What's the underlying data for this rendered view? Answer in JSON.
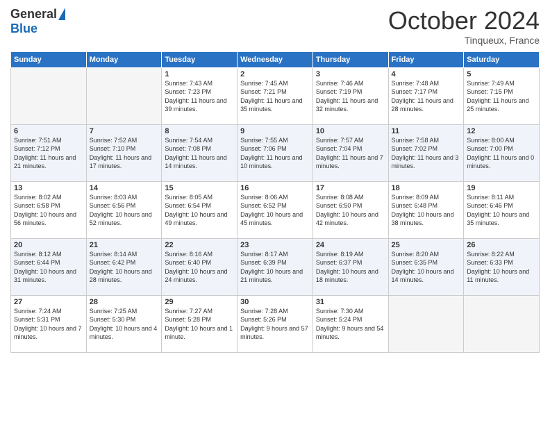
{
  "logo": {
    "general": "General",
    "blue": "Blue"
  },
  "title": "October 2024",
  "location": "Tinqueux, France",
  "days_header": [
    "Sunday",
    "Monday",
    "Tuesday",
    "Wednesday",
    "Thursday",
    "Friday",
    "Saturday"
  ],
  "weeks": [
    [
      {
        "day": "",
        "sunrise": "",
        "sunset": "",
        "daylight": ""
      },
      {
        "day": "",
        "sunrise": "",
        "sunset": "",
        "daylight": ""
      },
      {
        "day": "1",
        "sunrise": "Sunrise: 7:43 AM",
        "sunset": "Sunset: 7:23 PM",
        "daylight": "Daylight: 11 hours and 39 minutes."
      },
      {
        "day": "2",
        "sunrise": "Sunrise: 7:45 AM",
        "sunset": "Sunset: 7:21 PM",
        "daylight": "Daylight: 11 hours and 35 minutes."
      },
      {
        "day": "3",
        "sunrise": "Sunrise: 7:46 AM",
        "sunset": "Sunset: 7:19 PM",
        "daylight": "Daylight: 11 hours and 32 minutes."
      },
      {
        "day": "4",
        "sunrise": "Sunrise: 7:48 AM",
        "sunset": "Sunset: 7:17 PM",
        "daylight": "Daylight: 11 hours and 28 minutes."
      },
      {
        "day": "5",
        "sunrise": "Sunrise: 7:49 AM",
        "sunset": "Sunset: 7:15 PM",
        "daylight": "Daylight: 11 hours and 25 minutes."
      }
    ],
    [
      {
        "day": "6",
        "sunrise": "Sunrise: 7:51 AM",
        "sunset": "Sunset: 7:12 PM",
        "daylight": "Daylight: 11 hours and 21 minutes."
      },
      {
        "day": "7",
        "sunrise": "Sunrise: 7:52 AM",
        "sunset": "Sunset: 7:10 PM",
        "daylight": "Daylight: 11 hours and 17 minutes."
      },
      {
        "day": "8",
        "sunrise": "Sunrise: 7:54 AM",
        "sunset": "Sunset: 7:08 PM",
        "daylight": "Daylight: 11 hours and 14 minutes."
      },
      {
        "day": "9",
        "sunrise": "Sunrise: 7:55 AM",
        "sunset": "Sunset: 7:06 PM",
        "daylight": "Daylight: 11 hours and 10 minutes."
      },
      {
        "day": "10",
        "sunrise": "Sunrise: 7:57 AM",
        "sunset": "Sunset: 7:04 PM",
        "daylight": "Daylight: 11 hours and 7 minutes."
      },
      {
        "day": "11",
        "sunrise": "Sunrise: 7:58 AM",
        "sunset": "Sunset: 7:02 PM",
        "daylight": "Daylight: 11 hours and 3 minutes."
      },
      {
        "day": "12",
        "sunrise": "Sunrise: 8:00 AM",
        "sunset": "Sunset: 7:00 PM",
        "daylight": "Daylight: 11 hours and 0 minutes."
      }
    ],
    [
      {
        "day": "13",
        "sunrise": "Sunrise: 8:02 AM",
        "sunset": "Sunset: 6:58 PM",
        "daylight": "Daylight: 10 hours and 56 minutes."
      },
      {
        "day": "14",
        "sunrise": "Sunrise: 8:03 AM",
        "sunset": "Sunset: 6:56 PM",
        "daylight": "Daylight: 10 hours and 52 minutes."
      },
      {
        "day": "15",
        "sunrise": "Sunrise: 8:05 AM",
        "sunset": "Sunset: 6:54 PM",
        "daylight": "Daylight: 10 hours and 49 minutes."
      },
      {
        "day": "16",
        "sunrise": "Sunrise: 8:06 AM",
        "sunset": "Sunset: 6:52 PM",
        "daylight": "Daylight: 10 hours and 45 minutes."
      },
      {
        "day": "17",
        "sunrise": "Sunrise: 8:08 AM",
        "sunset": "Sunset: 6:50 PM",
        "daylight": "Daylight: 10 hours and 42 minutes."
      },
      {
        "day": "18",
        "sunrise": "Sunrise: 8:09 AM",
        "sunset": "Sunset: 6:48 PM",
        "daylight": "Daylight: 10 hours and 38 minutes."
      },
      {
        "day": "19",
        "sunrise": "Sunrise: 8:11 AM",
        "sunset": "Sunset: 6:46 PM",
        "daylight": "Daylight: 10 hours and 35 minutes."
      }
    ],
    [
      {
        "day": "20",
        "sunrise": "Sunrise: 8:12 AM",
        "sunset": "Sunset: 6:44 PM",
        "daylight": "Daylight: 10 hours and 31 minutes."
      },
      {
        "day": "21",
        "sunrise": "Sunrise: 8:14 AM",
        "sunset": "Sunset: 6:42 PM",
        "daylight": "Daylight: 10 hours and 28 minutes."
      },
      {
        "day": "22",
        "sunrise": "Sunrise: 8:16 AM",
        "sunset": "Sunset: 6:40 PM",
        "daylight": "Daylight: 10 hours and 24 minutes."
      },
      {
        "day": "23",
        "sunrise": "Sunrise: 8:17 AM",
        "sunset": "Sunset: 6:39 PM",
        "daylight": "Daylight: 10 hours and 21 minutes."
      },
      {
        "day": "24",
        "sunrise": "Sunrise: 8:19 AM",
        "sunset": "Sunset: 6:37 PM",
        "daylight": "Daylight: 10 hours and 18 minutes."
      },
      {
        "day": "25",
        "sunrise": "Sunrise: 8:20 AM",
        "sunset": "Sunset: 6:35 PM",
        "daylight": "Daylight: 10 hours and 14 minutes."
      },
      {
        "day": "26",
        "sunrise": "Sunrise: 8:22 AM",
        "sunset": "Sunset: 6:33 PM",
        "daylight": "Daylight: 10 hours and 11 minutes."
      }
    ],
    [
      {
        "day": "27",
        "sunrise": "Sunrise: 7:24 AM",
        "sunset": "Sunset: 5:31 PM",
        "daylight": "Daylight: 10 hours and 7 minutes."
      },
      {
        "day": "28",
        "sunrise": "Sunrise: 7:25 AM",
        "sunset": "Sunset: 5:30 PM",
        "daylight": "Daylight: 10 hours and 4 minutes."
      },
      {
        "day": "29",
        "sunrise": "Sunrise: 7:27 AM",
        "sunset": "Sunset: 5:28 PM",
        "daylight": "Daylight: 10 hours and 1 minute."
      },
      {
        "day": "30",
        "sunrise": "Sunrise: 7:28 AM",
        "sunset": "Sunset: 5:26 PM",
        "daylight": "Daylight: 9 hours and 57 minutes."
      },
      {
        "day": "31",
        "sunrise": "Sunrise: 7:30 AM",
        "sunset": "Sunset: 5:24 PM",
        "daylight": "Daylight: 9 hours and 54 minutes."
      },
      {
        "day": "",
        "sunrise": "",
        "sunset": "",
        "daylight": ""
      },
      {
        "day": "",
        "sunrise": "",
        "sunset": "",
        "daylight": ""
      }
    ]
  ]
}
